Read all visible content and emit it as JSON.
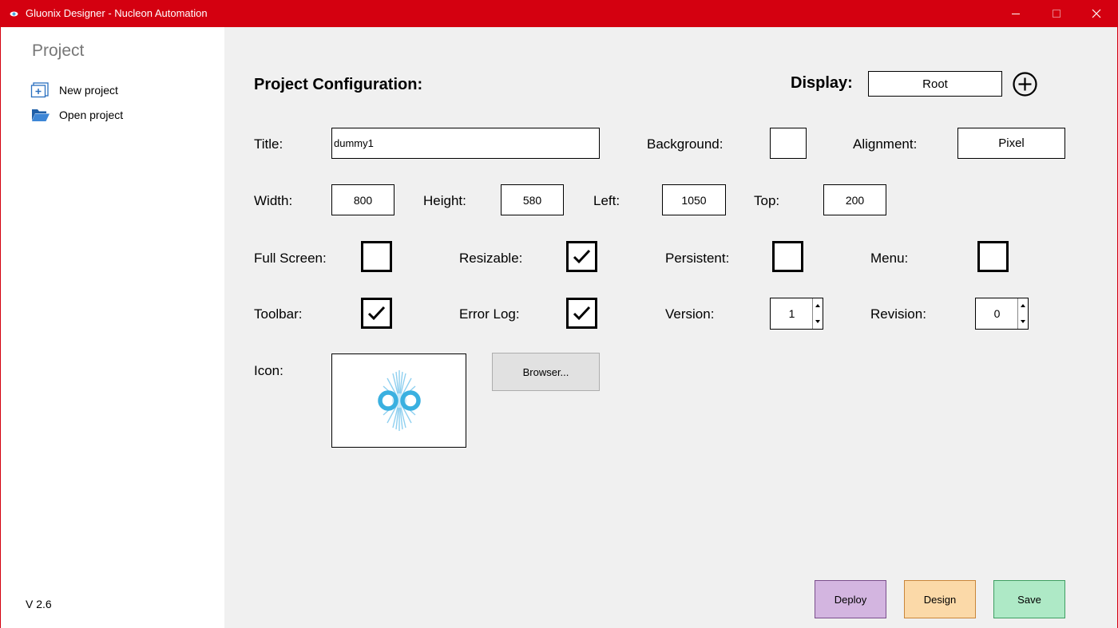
{
  "window": {
    "title": "Gluonix Designer - Nucleon Automation",
    "accent_color": "#d40010",
    "controls": [
      "minimize-icon",
      "maximize-icon",
      "close-icon"
    ]
  },
  "sidebar": {
    "title": "Project",
    "items": [
      {
        "label": "New project",
        "icon": "new-project-icon"
      },
      {
        "label": "Open project",
        "icon": "folder-open-icon"
      }
    ],
    "version": "V 2.6"
  },
  "config": {
    "heading": "Project Configuration:",
    "display_label": "Display:",
    "display_value": "Root",
    "title_label": "Title:",
    "title_value": "dummy1",
    "background_label": "Background:",
    "background_color": "#ffffff",
    "alignment_label": "Alignment:",
    "alignment_value": "Pixel",
    "width_label": "Width:",
    "width_value": "800",
    "height_label": "Height:",
    "height_value": "580",
    "left_label": "Left:",
    "left_value": "1050",
    "top_label": "Top:",
    "top_value": "200",
    "fullscreen_label": "Full Screen:",
    "fullscreen_checked": false,
    "resizable_label": "Resizable:",
    "resizable_checked": true,
    "persistent_label": "Persistent:",
    "persistent_checked": false,
    "menu_label": "Menu:",
    "menu_checked": false,
    "toolbar_label": "Toolbar:",
    "toolbar_checked": true,
    "errorlog_label": "Error Log:",
    "errorlog_checked": true,
    "version_label": "Version:",
    "version_value": "1",
    "revision_label": "Revision:",
    "revision_value": "0",
    "icon_label": "Icon:",
    "browse_label": "Browser..."
  },
  "actions": {
    "deploy": {
      "label": "Deploy",
      "color": "#d3b5e0"
    },
    "design": {
      "label": "Design",
      "color": "#fbd9a8"
    },
    "save": {
      "label": "Save",
      "color": "#aee9c6"
    }
  }
}
